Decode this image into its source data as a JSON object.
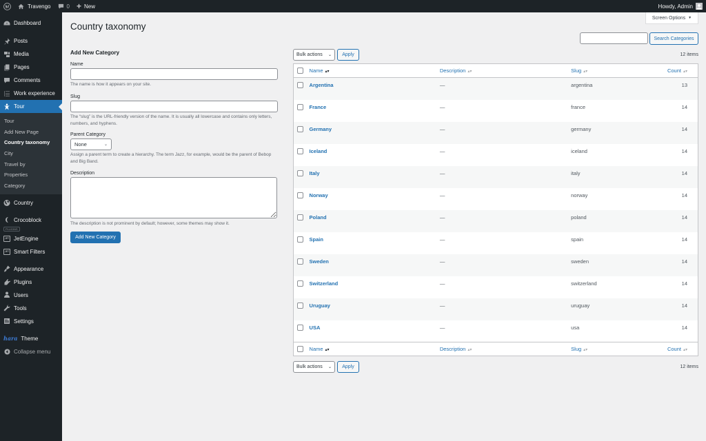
{
  "adminbar": {
    "site_name": "Travengo",
    "comments_count": "0",
    "new_label": "New",
    "howdy": "Howdy, Admin"
  },
  "sidebar": {
    "items_top": [
      {
        "label": "Dashboard",
        "icon": "dashboard-icon"
      }
    ],
    "items_main": [
      {
        "label": "Posts",
        "icon": "pin-icon"
      },
      {
        "label": "Media",
        "icon": "media-icon"
      },
      {
        "label": "Pages",
        "icon": "pages-icon"
      },
      {
        "label": "Comments",
        "icon": "comments-icon"
      },
      {
        "label": "Work experience",
        "icon": "list-icon"
      }
    ],
    "current": {
      "label": "Tour",
      "icon": "star-person-icon"
    },
    "submenu": [
      {
        "label": "Tour",
        "current": false
      },
      {
        "label": "Add New Page",
        "current": false
      },
      {
        "label": "Country taxonomy",
        "current": true
      },
      {
        "label": "City",
        "current": false
      },
      {
        "label": "Travel by",
        "current": false
      },
      {
        "label": "Properties",
        "current": false
      },
      {
        "label": "Category",
        "current": false
      }
    ],
    "country": "Country",
    "crocoblock": "Crocoblock",
    "plugins_sep": "PLUGINS",
    "jetengine": "JetEngine",
    "smart_filters": "Smart Filters",
    "jet_icon_text": "JET",
    "items_admin": [
      {
        "label": "Appearance",
        "icon": "brush-icon"
      },
      {
        "label": "Plugins",
        "icon": "plugin-icon"
      },
      {
        "label": "Users",
        "icon": "users-icon"
      },
      {
        "label": "Tools",
        "icon": "wrench-icon"
      },
      {
        "label": "Settings",
        "icon": "settings-icon"
      }
    ],
    "theme_logo": "hara",
    "theme": "Theme",
    "collapse": "Collapse menu"
  },
  "screen_options": "Screen Options",
  "page_title": "Country taxonomy",
  "search": {
    "value": "",
    "button": "Search Categories"
  },
  "form": {
    "heading": "Add New Category",
    "name_label": "Name",
    "name_value": "",
    "name_help": "The name is how it appears on your site.",
    "slug_label": "Slug",
    "slug_value": "",
    "slug_help": "The “slug” is the URL-friendly version of the name. It is usually all lowercase and contains only letters, numbers, and hyphens.",
    "parent_label": "Parent Category",
    "parent_value": "None",
    "parent_help": "Assign a parent term to create a hierarchy. The term Jazz, for example, would be the parent of Bebop and Big Band.",
    "desc_label": "Description",
    "desc_value": "",
    "desc_help": "The description is not prominent by default; however, some themes may show it.",
    "submit": "Add New Category"
  },
  "list": {
    "bulk_actions": "Bulk actions",
    "apply": "Apply",
    "items_count": "12 items",
    "columns": {
      "name": "Name",
      "description": "Description",
      "slug": "Slug",
      "count": "Count"
    },
    "rows": [
      {
        "name": "Argentina",
        "description": "—",
        "slug": "argentina",
        "count": "13"
      },
      {
        "name": "France",
        "description": "—",
        "slug": "france",
        "count": "14"
      },
      {
        "name": "Germany",
        "description": "—",
        "slug": "germany",
        "count": "14"
      },
      {
        "name": "Iceland",
        "description": "—",
        "slug": "iceland",
        "count": "14"
      },
      {
        "name": "Italy",
        "description": "—",
        "slug": "italy",
        "count": "14"
      },
      {
        "name": "Norway",
        "description": "—",
        "slug": "norway",
        "count": "14"
      },
      {
        "name": "Poland",
        "description": "—",
        "slug": "poland",
        "count": "14"
      },
      {
        "name": "Spain",
        "description": "—",
        "slug": "spain",
        "count": "14"
      },
      {
        "name": "Sweden",
        "description": "—",
        "slug": "sweden",
        "count": "14"
      },
      {
        "name": "Switzerland",
        "description": "—",
        "slug": "switzerland",
        "count": "14"
      },
      {
        "name": "Uruguay",
        "description": "—",
        "slug": "uruguay",
        "count": "14"
      },
      {
        "name": "USA",
        "description": "—",
        "slug": "usa",
        "count": "14"
      }
    ]
  },
  "colors": {
    "accent": "#2271b1",
    "sidebar_bg": "#1d2327",
    "page_bg": "#f0f0f1"
  }
}
